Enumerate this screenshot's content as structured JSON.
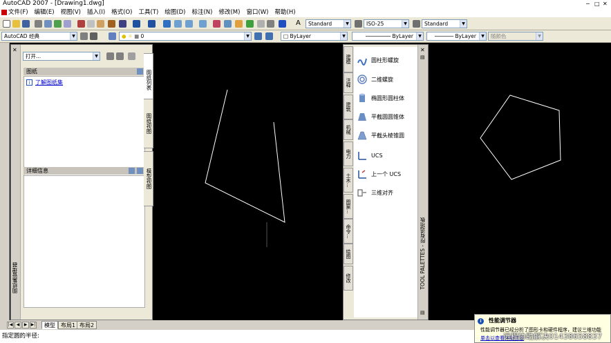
{
  "window": {
    "title": "AutoCAD 2007 - [Drawing1.dwg]"
  },
  "menu": [
    "文件(F)",
    "编辑(E)",
    "视图(V)",
    "插入(I)",
    "格式(O)",
    "工具(T)",
    "绘图(D)",
    "标注(N)",
    "修改(M)",
    "窗口(W)",
    "帮助(H)"
  ],
  "toolbar": {
    "text_style": "Standard",
    "dim_style": "ISO-25",
    "table_style": "Standard",
    "workspace": "AutoCAD 经典",
    "layer": "0",
    "color": "ByLayer",
    "linetype": "ByLayer",
    "lineweight": "ByLayer",
    "plotstyle": "随颜色"
  },
  "sheetset": {
    "open_combo": "打开...",
    "sheets_header": "图纸",
    "sheets_link": "了解图纸集",
    "details_header": "详细信息",
    "title": "图纸集管理器",
    "tabs": [
      "图纸列表",
      "图纸视图",
      "模型视图"
    ]
  },
  "toolpalette": {
    "title": "TOOL PALETTES - 所有选项板",
    "tabs": [
      "建模",
      "注释",
      "建筑",
      "机械",
      "电力",
      "土木...",
      "图案...",
      "命令...",
      "绘图",
      "修改"
    ],
    "items": [
      "圆柱形螺旋",
      "二维螺旋",
      "椭圆形圆柱体",
      "平截圆圆锥体",
      "平截头棱锥圆",
      "UCS",
      "上一个 UCS",
      "三维对齐"
    ]
  },
  "layout_tabs": [
    "模型",
    "布局1",
    "布局2"
  ],
  "command": {
    "prompt": "指定圆的半径:"
  },
  "notification": {
    "title": "性能调节器",
    "body": "性能调节器已经分析了图形卡和硬件程序，建议三维功能",
    "link": "单击以查看详细信息"
  },
  "overlay": {
    "text": "远程协助解决01438658837"
  }
}
